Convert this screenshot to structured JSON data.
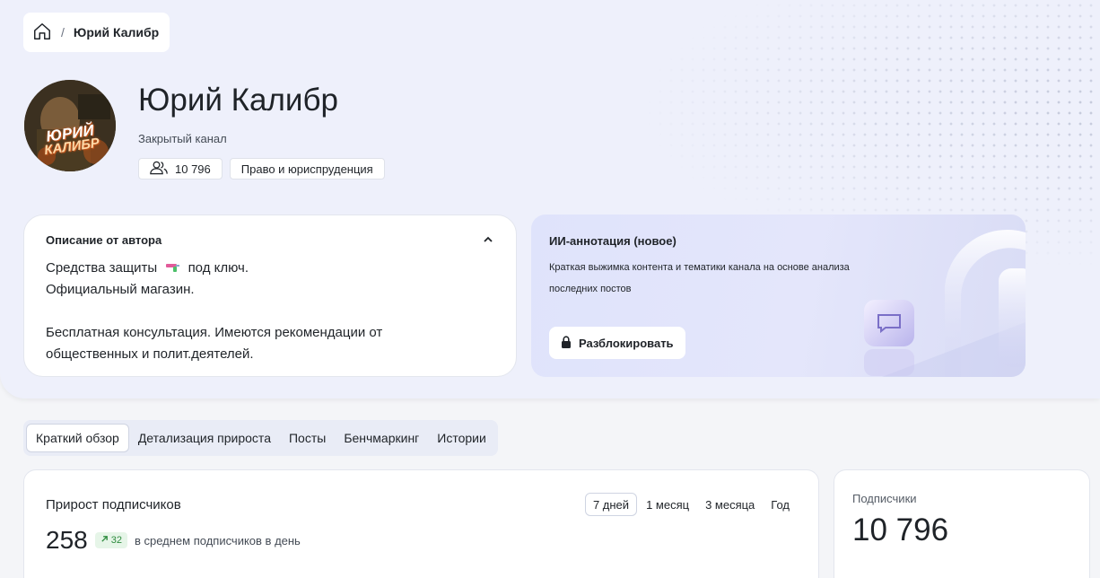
{
  "breadcrumb": {
    "current": "Юрий Калибр"
  },
  "channel": {
    "title": "Юрий Калибр",
    "type": "Закрытый канал",
    "subscribers_chip": "10 796",
    "category": "Право и юриспруденция",
    "avatar_text_1": "ЮРИЙ",
    "avatar_text_2": "КАЛИБР"
  },
  "description": {
    "title": "Описание от автора",
    "line1a": "Средства защиты",
    "line1b": "под ключ.",
    "line2": "Официальный магазин.",
    "line3": "Бесплатная консультация. Имеются рекомендации от",
    "line4": "общественных и полит.деятелей."
  },
  "ai": {
    "title": "ИИ-аннотация (новое)",
    "subtitle": "Краткая выжимка контента и тематики канала на основе анализа последних постов",
    "unlock": "Разблокировать"
  },
  "tabs": [
    {
      "label": "Краткий обзор",
      "active": true
    },
    {
      "label": "Детализация прироста"
    },
    {
      "label": "Посты"
    },
    {
      "label": "Бенчмаркинг"
    },
    {
      "label": "Истории"
    }
  ],
  "growth": {
    "title": "Прирост подписчиков",
    "periods": [
      "7 дней",
      "1 месяц",
      "3 месяца",
      "Год"
    ],
    "active_period": "7 дней",
    "value": "258",
    "trend": "32",
    "avg_label": "в среднем подписчиков в день"
  },
  "subscribers": {
    "label": "Подписчики",
    "value": "10 796"
  },
  "colors": {
    "accent_green": "#2e8b3e",
    "ai_bg": "#dfe3fb",
    "hero_bg": "#eef0fb"
  }
}
